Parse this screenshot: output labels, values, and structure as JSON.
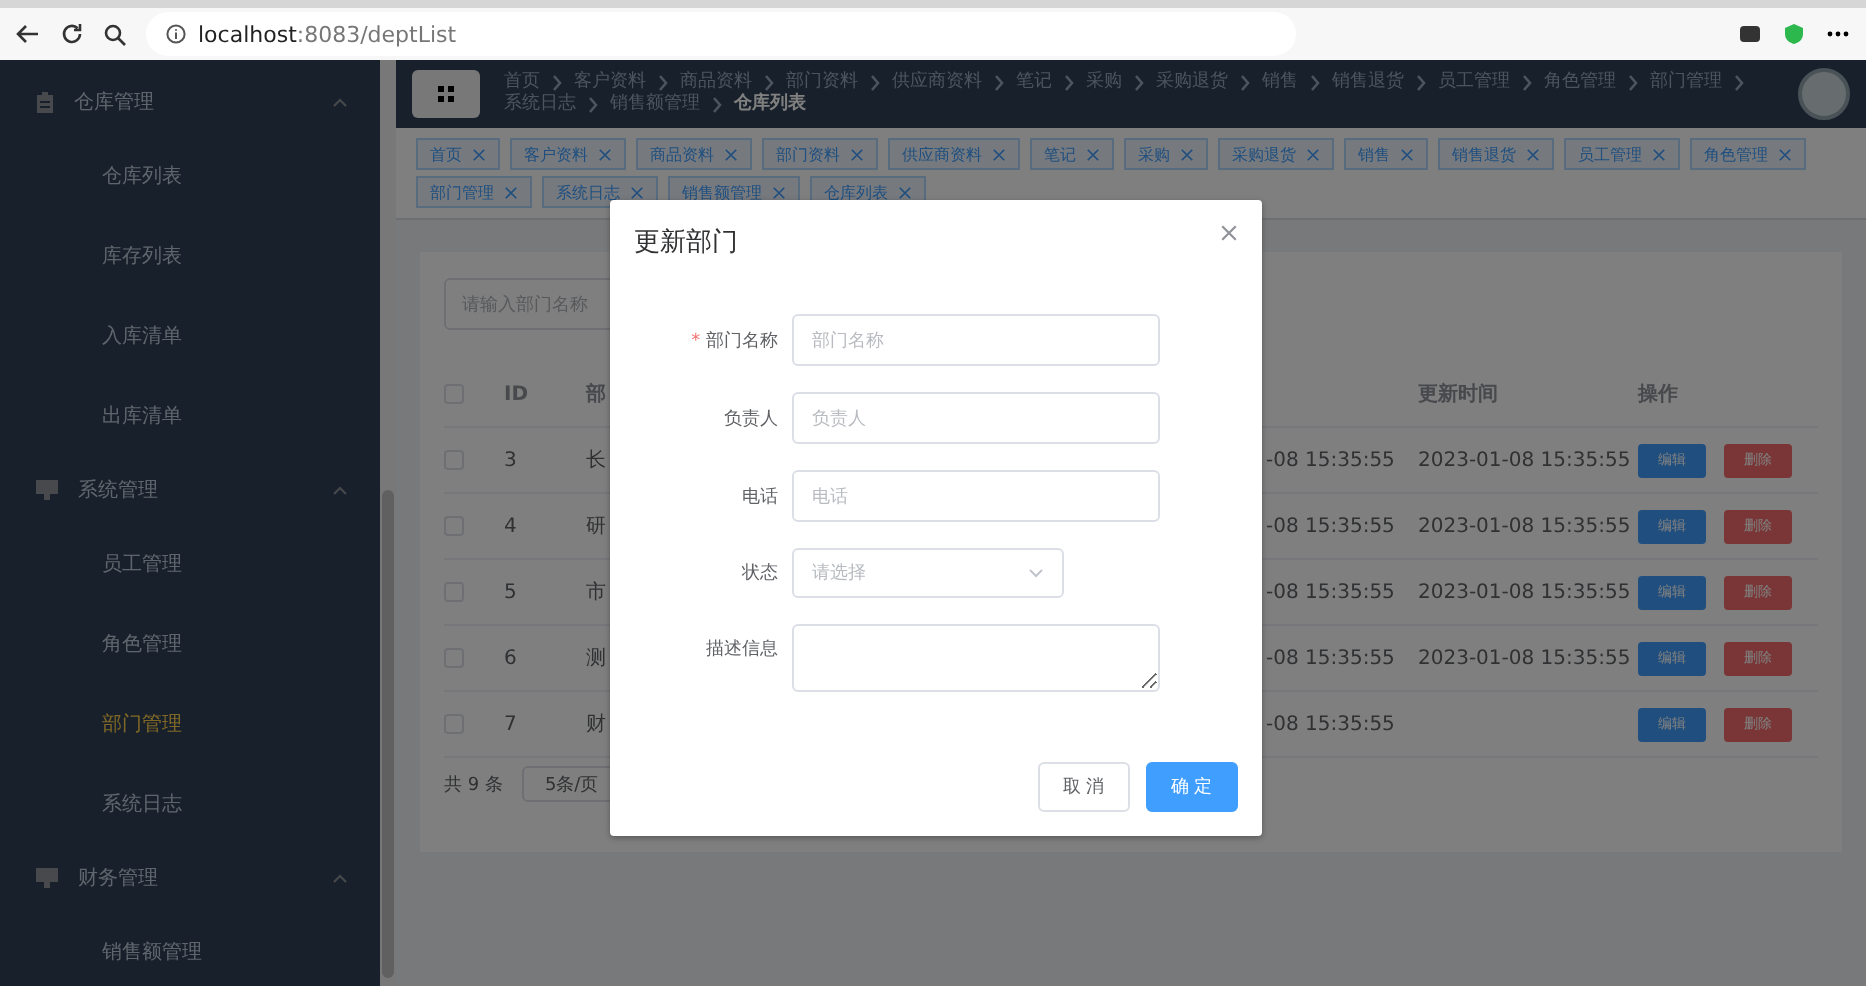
{
  "browser": {
    "host": "localhost",
    "path": ":8083/deptList"
  },
  "sidebar": {
    "groups": [
      {
        "label": "仓库管理",
        "expanded": true,
        "items": [
          {
            "label": "仓库列表",
            "selected": false
          },
          {
            "label": "库存列表",
            "selected": false
          },
          {
            "label": "入库清单",
            "selected": false
          },
          {
            "label": "出库清单",
            "selected": false
          }
        ]
      },
      {
        "label": "系统管理",
        "expanded": true,
        "items": [
          {
            "label": "员工管理",
            "selected": false
          },
          {
            "label": "角色管理",
            "selected": false
          },
          {
            "label": "部门管理",
            "selected": true
          },
          {
            "label": "系统日志",
            "selected": false
          }
        ]
      },
      {
        "label": "财务管理",
        "expanded": true,
        "items": [
          {
            "label": "销售额管理",
            "selected": false
          }
        ]
      }
    ]
  },
  "header": {
    "breadcrumb": [
      "首页",
      "客户资料",
      "商品资料",
      "部门资料",
      "供应商资料",
      "笔记",
      "采购",
      "采购退货",
      "销售",
      "销售退货",
      "员工管理",
      "角色管理",
      "部门管理",
      "系统日志",
      "销售额管理",
      "仓库列表"
    ]
  },
  "tags": [
    "首页",
    "客户资料",
    "商品资料",
    "部门资料",
    "供应商资料",
    "笔记",
    "采购",
    "采购退货",
    "销售",
    "销售退货",
    "员工管理",
    "角色管理",
    "部门管理",
    "系统日志",
    "销售额管理",
    "仓库列表"
  ],
  "search": {
    "placeholder": "请输入部门名称"
  },
  "table": {
    "all_checked": false,
    "columns": [
      "ID",
      "部",
      "更新时间",
      "操作"
    ],
    "rows": [
      {
        "checked": false,
        "id": "3",
        "name": "长",
        "created": "-08 15:35:55",
        "updated": "2023-01-08 15:35:55",
        "actions": [
          "编辑",
          "删除"
        ]
      },
      {
        "checked": false,
        "id": "4",
        "name": "研",
        "created": "-08 15:35:55",
        "updated": "2023-01-08 15:35:55",
        "actions": [
          "编辑",
          "删除"
        ]
      },
      {
        "checked": false,
        "id": "5",
        "name": "市",
        "created": "-08 15:35:55",
        "updated": "2023-01-08 15:35:55",
        "actions": [
          "编辑",
          "删除"
        ]
      },
      {
        "checked": false,
        "id": "6",
        "name": "测",
        "created": "-08 15:35:55",
        "updated": "2023-01-08 15:35:55",
        "actions": [
          "编辑",
          "删除"
        ]
      },
      {
        "checked": false,
        "id": "7",
        "name": "财",
        "created": "-08 15:35:55",
        "actions": [
          "编辑",
          "删除"
        ]
      }
    ]
  },
  "pagination": {
    "total": "共 9 条",
    "page_size": "5条/页"
  },
  "dialog": {
    "title": "更新部门",
    "fields": [
      {
        "kind": "input",
        "required_mark": "*",
        "label": "部门名称",
        "placeholder": "部门名称"
      },
      {
        "kind": "input",
        "label": "负责人",
        "placeholder": "负责人"
      },
      {
        "kind": "input",
        "label": "电话",
        "placeholder": "电话"
      },
      {
        "kind": "select",
        "label": "状态",
        "placeholder": "请选择"
      },
      {
        "kind": "textarea",
        "label": "描述信息"
      }
    ],
    "buttons": [
      {
        "label": "取 消",
        "kind": "default"
      },
      {
        "label": "确 定",
        "kind": "primary"
      }
    ]
  }
}
